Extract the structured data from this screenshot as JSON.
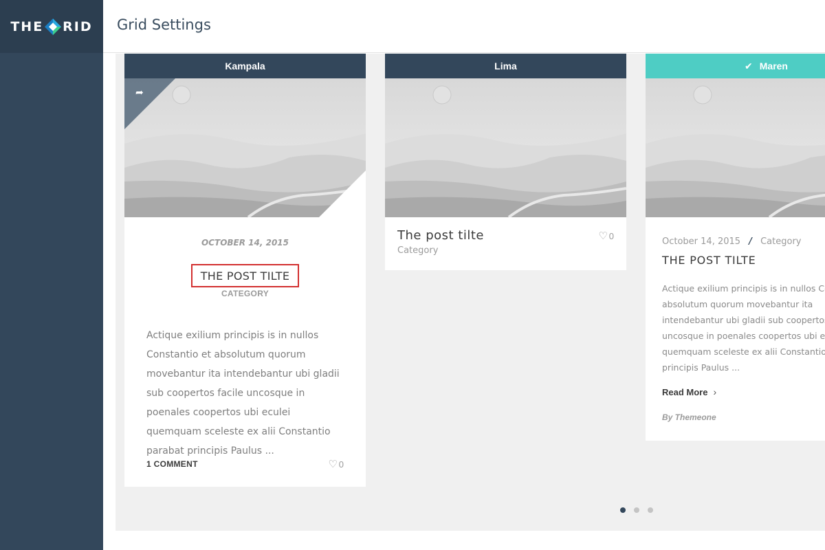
{
  "brand": {
    "logo_left": "THE",
    "logo_right": "RID",
    "logo_colors": [
      "#2aa9e0",
      "#3ecf8e",
      "#1b7fc4"
    ]
  },
  "header": {
    "title": "Grid Settings"
  },
  "cards": [
    {
      "head": "Kampala",
      "date": "OCTOBER 14, 2015",
      "title": "THE POST TILTE",
      "category": "CATEGORY",
      "excerpt": "Actique exilium principis is in nullos Constantio et absolutum quorum movebantur ita intendebantur ubi gladii sub coopertos facile uncosque in poenales coopertos ubi eculei quemquam sceleste ex alii Constantio parabat principis Paulus ...",
      "comments": "1 COMMENT",
      "likes": "0",
      "share_icon": "share-icon"
    },
    {
      "head": "Lima",
      "title": "The post tilte",
      "category": "Category",
      "likes": "0"
    },
    {
      "head": "Maren",
      "head_icon": "check-icon",
      "date": "October 14, 2015",
      "separator": "/",
      "category": "Category",
      "title": "THE POST TILTE",
      "excerpt_lines": [
        "Actique exilium principis is in nullos Con",
        "absolutum quorum movebantur ita",
        "intendebantur ubi gladii sub coopertos",
        "uncosque in poenales coopertos ubi ec",
        "quemquam sceleste ex alii Constantio p",
        "principis Paulus ..."
      ],
      "read_more": "Read More",
      "author": "By Themeone"
    }
  ],
  "pagination": {
    "pages": 3,
    "current": 1
  },
  "colors": {
    "sidebar": "#33475b",
    "accent": "#4ecdc4",
    "highlight": "#d22e2e"
  }
}
